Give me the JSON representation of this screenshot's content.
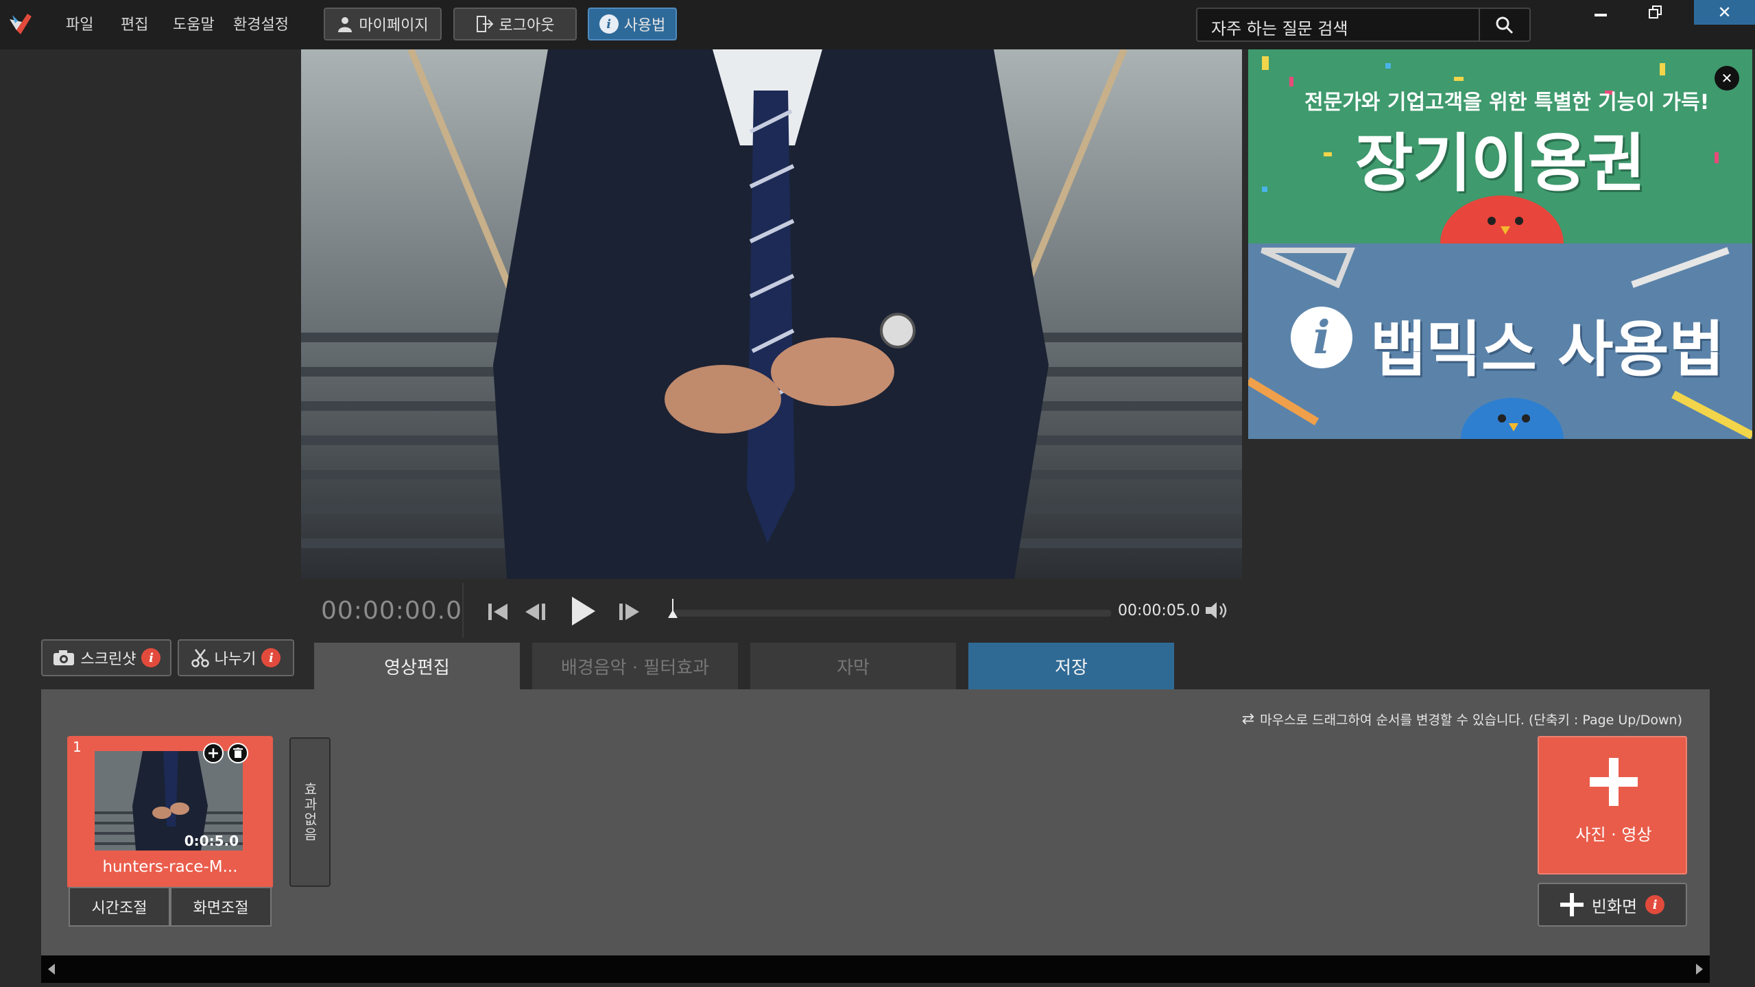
{
  "menu": [
    "파일",
    "편집",
    "도움말",
    "환경설정"
  ],
  "toolbar": {
    "mypage": "마이페이지",
    "logout": "로그아웃",
    "howto": "사용법"
  },
  "search": {
    "text": "자주 하는 질문 검색",
    "icon": "search-icon"
  },
  "ad": {
    "subtitle": "전문가와 기업고객을 위한 특별한 기능이 가득!",
    "title": "장기이용권",
    "guide_title": "뱁믹스 사용법"
  },
  "player": {
    "timecode": "00:00:00.0",
    "end_time": "00:00:05.0",
    "progress": 0
  },
  "tools": {
    "screenshot": "스크린샷",
    "split": "나누기"
  },
  "tabs": [
    "영상편집",
    "배경음악 · 필터효과",
    "자막",
    "저장"
  ],
  "panel": {
    "hint": "마우스로 드래그하여 순서를 변경할 수 있습니다.  (단축키 : Page Up/Down)",
    "clip": {
      "index": "1",
      "duration": "0:0:5.0",
      "name": "hunters-race-M...",
      "time_adjust": "시간조절",
      "screen_adjust": "화면조절"
    },
    "effect_none": "효과없음",
    "add_media": "사진 · 영상",
    "add_blank": "빈화면"
  },
  "colors": {
    "accent_red": "#e95c4a",
    "accent_blue": "#2f6a95",
    "background": "#2b2b2b"
  }
}
